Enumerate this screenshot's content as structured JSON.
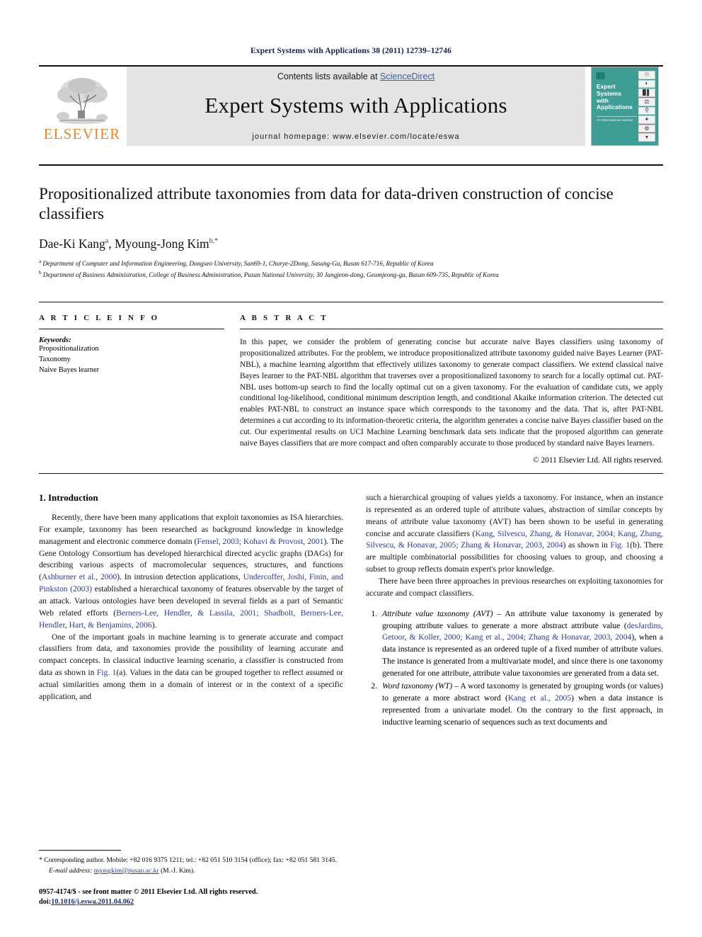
{
  "running_head": "Expert Systems with Applications 38 (2011) 12739–12746",
  "masthead": {
    "contents_prefix": "Contents lists available at ",
    "sciencedirect": "ScienceDirect",
    "journal_title": "Expert Systems with Applications",
    "homepage": "journal homepage: www.elsevier.com/locate/eswa",
    "publisher_wordmark": "ELSEVIER",
    "publisher_color": "#e8862b",
    "band_color": "#e4e4e4",
    "cover": {
      "title_line1": "Expert",
      "title_line2": "Systems",
      "title_line3": "with",
      "title_line4": "Applications",
      "subtitle": "An International Journal",
      "bg_color": "#3e9e96",
      "icons": [
        "globe-icon",
        "pie-chart-icon",
        "bar-chart-icon",
        "scales-icon",
        "microscope-icon",
        "satellite-icon",
        "flask-icon",
        "drill-icon"
      ]
    }
  },
  "article": {
    "title": "Propositionalized attribute taxonomies from data for data-driven construction of concise classifiers",
    "authors_html": "Dae-Ki Kang<sup>a</sup>, Myoung-Jong Kim<sup>b,</sup><sup>*</sup>",
    "affiliations": [
      {
        "marker": "a",
        "text": "Department of Computer and Information Engineering, Dongseo University, San69-1, Churye-2Dong, Sasang-Gu, Busan 617-716, Republic of Korea"
      },
      {
        "marker": "b",
        "text": "Department of Business Administration, College of Business Administration, Pusan National University, 30 Jangjeon-dong, Geumjeong-gu, Busan 609-735, Republic of Korea"
      }
    ]
  },
  "article_info": {
    "heading": "A R T I C L E   I N F O",
    "keywords_label": "Keywords:",
    "keywords": [
      "Propositionalization",
      "Taxonomy",
      "Naive Bayes learner"
    ]
  },
  "abstract": {
    "heading": "A B S T R A C T",
    "text": "In this paper, we consider the problem of generating concise but accurate naive Bayes classifiers using taxonomy of propositionalized attributes. For the problem, we introduce propositionalized attribute taxonomy guided naive Bayes Learner (PAT-NBL), a machine learning algorithm that effectively utilizes taxonomy to generate compact classifiers. We extend classical naive Bayes learner to the PAT-NBL algorithm that traverses over a propositionalized taxonomy to search for a locally optimal cut. PAT-NBL uses bottom-up search to find the locally optimal cut on a given taxonomy. For the evaluation of candidate cuts, we apply conditional log-likelihood, conditional minimum description length, and conditional Akaike information criterion. The detected cut enables PAT-NBL to construct an instance space which corresponds to the taxonomy and the data. That is, after PAT-NBL determines a cut according to its information-theoretic criteria, the algorithm generates a concise naive Bayes classifier based on the cut. Our experimental results on UCI Machine Learning benchmark data sets indicate that the proposed algorithm can generate naive Bayes classifiers that are more compact and often comparably accurate to those produced by standard naive Bayes learners.",
    "copyright": "© 2011 Elsevier Ltd. All rights reserved."
  },
  "introduction": {
    "heading": "1. Introduction",
    "left_paragraphs": [
      "Recently, there have been many applications that exploit taxonomies as ISA hierarchies. For example, taxonomy has been researched as background knowledge in knowledge management and electronic commerce domain (<span class=\"cite\">Fensel, 2003; Kohavi &amp; Provost, 2001</span>). The Gene Ontology Consortium has developed hierarchical directed acyclic graphs (DAGs) for describing various aspects of macromolecular sequences, structures, and functions (<span class=\"cite\">Ashburner et al., 2000</span>). In intrusion detection applications, <span class=\"cite\">Undercoffer, Joshi, Finin, and Pinkston (2003)</span> established a hierarchical taxonomy of features observable by the target of an attack. Various ontologies have been developed in several fields as a part of Semantic Web related efforts (<span class=\"cite\">Berners-Lee, Hendler, &amp; Lassila, 2001; Shadbolt, Berners-Lee, Hendler, Hart, &amp; Benjamins, 2006</span>).",
      "One of the important goals in machine learning is to generate accurate and compact classifiers from data, and taxonomies provide the possibility of learning accurate and compact concepts. In classical inductive learning scenario, a classifier is constructed from data as shown in <span class=\"cite\">Fig. 1</span>(a). Values in the data can be grouped together to reflect assumed or actual similarities among them in a domain of interest or in the context of a specific application, and"
    ],
    "right_paragraphs": [
      "such a hierarchical grouping of values yields a taxonomy. For instance, when an instance is represented as an ordered tuple of attribute values, abstraction of similar concepts by means of attribute value taxonomy (AVT) has been shown to be useful in generating concise and accurate classifiers (<span class=\"cite\">Kang, Silvescu, Zhang, &amp; Honavar, 2004; Kang, Zhang, Silvescu, &amp; Honavar, 2005; Zhang &amp; Honavar, 2003, 2004</span>) as shown in <span class=\"cite\">Fig. 1</span>(b). There are multiple combinatorial possibilities for choosing values to group, and choosing a subset to group reflects domain expert's prior knowledge.",
      "There have been three approaches in previous researches on exploiting taxonomies for accurate and compact classifiers."
    ],
    "approaches": [
      "<em>Attribute value taxonomy (AVT)</em> – An attribute value taxonomy is generated by grouping attribute values to generate a more abstract attribute value (<span class=\"cite\">desJardins, Getoor, &amp; Koller, 2000; Kang et al., 2004; Zhang &amp; Honavar, 2003, 2004</span>), when a data instance is represented as an ordered tuple of a fixed number of attribute values. The instance is generated from a multivariate model, and since there is one taxonomy generated for one attribute, attribute value taxonomies are generated from a data set.",
      "<em>Word taxonomy (WT)</em> – A word taxonomy is generated by grouping words (or values) to generate a more abstract word (<span class=\"cite\">Kang et al., 2005</span>) when a data instance is represented from a univariate model. On the contrary to the first approach, in inductive learning scenario of sequences such as text documents and"
    ]
  },
  "footnote": {
    "corresponding": "* Corresponding author. Mobile: +82 016 9375 1211; tel.: +82 051 510 3154 (office); fax: +82 051 581 3145.",
    "email_label": "E-mail address:",
    "email": "mjongkim@pusan.ac.kr",
    "email_suffix": "(M.-J. Kim).",
    "issn_line": "0957-4174/$ - see front matter © 2011 Elsevier Ltd. All rights reserved.",
    "doi_label": "doi:",
    "doi": "10.1016/j.eswa.2011.04.062"
  }
}
